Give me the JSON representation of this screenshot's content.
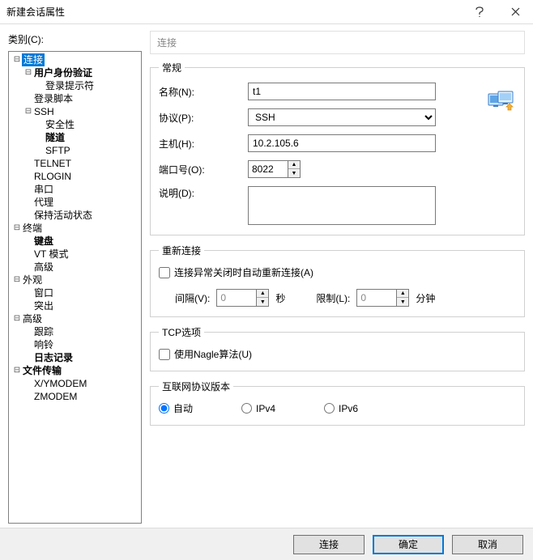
{
  "title": "新建会话属性",
  "category_label": "类别(C):",
  "tree": {
    "items": [
      {
        "id": "connection",
        "label": "连接",
        "bold": false,
        "depth": 0,
        "twisty": "-",
        "selected": true
      },
      {
        "id": "auth",
        "label": "用户身份验证",
        "bold": true,
        "depth": 1,
        "twisty": "-"
      },
      {
        "id": "login-prompt",
        "label": "登录提示符",
        "bold": false,
        "depth": 2,
        "twisty": ""
      },
      {
        "id": "login-scripts",
        "label": "登录脚本",
        "bold": false,
        "depth": 1,
        "twisty": ""
      },
      {
        "id": "ssh",
        "label": "SSH",
        "bold": false,
        "depth": 1,
        "twisty": "-"
      },
      {
        "id": "security",
        "label": "安全性",
        "bold": false,
        "depth": 2,
        "twisty": ""
      },
      {
        "id": "tunneling",
        "label": "隧道",
        "bold": true,
        "depth": 2,
        "twisty": ""
      },
      {
        "id": "sftp",
        "label": "SFTP",
        "bold": false,
        "depth": 2,
        "twisty": ""
      },
      {
        "id": "telnet",
        "label": "TELNET",
        "bold": false,
        "depth": 1,
        "twisty": ""
      },
      {
        "id": "rlogin",
        "label": "RLOGIN",
        "bold": false,
        "depth": 1,
        "twisty": ""
      },
      {
        "id": "serial",
        "label": "串口",
        "bold": false,
        "depth": 1,
        "twisty": ""
      },
      {
        "id": "proxy",
        "label": "代理",
        "bold": false,
        "depth": 1,
        "twisty": ""
      },
      {
        "id": "keepalive",
        "label": "保持活动状态",
        "bold": false,
        "depth": 1,
        "twisty": ""
      },
      {
        "id": "terminal",
        "label": "终端",
        "bold": false,
        "depth": 0,
        "twisty": "-"
      },
      {
        "id": "keyboard",
        "label": "键盘",
        "bold": true,
        "depth": 1,
        "twisty": ""
      },
      {
        "id": "vt",
        "label": "VT 模式",
        "bold": false,
        "depth": 1,
        "twisty": ""
      },
      {
        "id": "advanced-term",
        "label": "高级",
        "bold": false,
        "depth": 1,
        "twisty": ""
      },
      {
        "id": "appearance",
        "label": "外观",
        "bold": false,
        "depth": 0,
        "twisty": "-"
      },
      {
        "id": "window",
        "label": "窗口",
        "bold": false,
        "depth": 1,
        "twisty": ""
      },
      {
        "id": "highlight",
        "label": "突出",
        "bold": false,
        "depth": 1,
        "twisty": ""
      },
      {
        "id": "advanced",
        "label": "高级",
        "bold": false,
        "depth": 0,
        "twisty": "-"
      },
      {
        "id": "trace",
        "label": "跟踪",
        "bold": false,
        "depth": 1,
        "twisty": ""
      },
      {
        "id": "bell",
        "label": "响铃",
        "bold": false,
        "depth": 1,
        "twisty": ""
      },
      {
        "id": "logging",
        "label": "日志记录",
        "bold": true,
        "depth": 1,
        "twisty": ""
      },
      {
        "id": "filetransfer",
        "label": "文件传输",
        "bold": true,
        "depth": 0,
        "twisty": "-"
      },
      {
        "id": "xymodem",
        "label": "X/YMODEM",
        "bold": false,
        "depth": 1,
        "twisty": ""
      },
      {
        "id": "zmodem",
        "label": "ZMODEM",
        "bold": false,
        "depth": 1,
        "twisty": ""
      }
    ]
  },
  "panel": {
    "header": "连接",
    "general": {
      "legend": "常规",
      "name_label": "名称(N):",
      "name_value": "t1",
      "protocol_label": "协议(P):",
      "protocol_value": "SSH",
      "host_label": "主机(H):",
      "host_value": "10.2.105.6",
      "port_label": "端口号(O):",
      "port_value": "8022",
      "desc_label": "说明(D):",
      "desc_value": ""
    },
    "reconnect": {
      "legend": "重新连接",
      "checkbox_label": "连接异常关闭时自动重新连接(A)",
      "checked": false,
      "interval_label": "间隔(V):",
      "interval_value": "0",
      "interval_unit": "秒",
      "limit_label": "限制(L):",
      "limit_value": "0",
      "limit_unit": "分钟"
    },
    "tcp": {
      "legend": "TCP选项",
      "nagle_label": "使用Nagle算法(U)",
      "nagle_checked": false
    },
    "ipver": {
      "legend": "互联网协议版本",
      "auto": "自动",
      "ipv4": "IPv4",
      "ipv6": "IPv6",
      "selected": "auto"
    }
  },
  "footer": {
    "connect": "连接",
    "ok": "确定",
    "cancel": "取消"
  }
}
